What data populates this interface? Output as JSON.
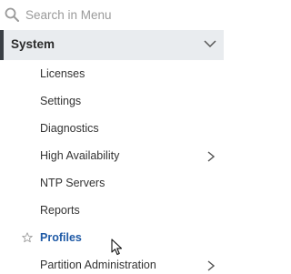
{
  "search": {
    "placeholder": "Search in Menu",
    "value": ""
  },
  "section": {
    "title": "System",
    "expanded": true,
    "indicator_color": "#3a3f45",
    "background": "#e9ecef"
  },
  "menu_items": [
    {
      "label": "Licenses",
      "has_submenu": false,
      "active": false
    },
    {
      "label": "Settings",
      "has_submenu": false,
      "active": false
    },
    {
      "label": "Diagnostics",
      "has_submenu": false,
      "active": false
    },
    {
      "label": "High Availability",
      "has_submenu": true,
      "active": false
    },
    {
      "label": "NTP Servers",
      "has_submenu": false,
      "active": false
    },
    {
      "label": "Reports",
      "has_submenu": false,
      "active": false
    },
    {
      "label": "Profiles",
      "has_submenu": false,
      "active": true,
      "favorite_icon": "star-icon"
    },
    {
      "label": "Partition Administration",
      "has_submenu": true,
      "active": false
    }
  ],
  "colors": {
    "active_text": "#1f5aa6",
    "text": "#333333",
    "placeholder": "#9a9a9a",
    "icon": "#9a9a9a"
  },
  "icons": {
    "search": "search-icon",
    "section_toggle": "chevron-down-icon",
    "submenu": "chevron-right-icon",
    "favorite": "star-icon",
    "pointer": "mouse-cursor-icon"
  }
}
